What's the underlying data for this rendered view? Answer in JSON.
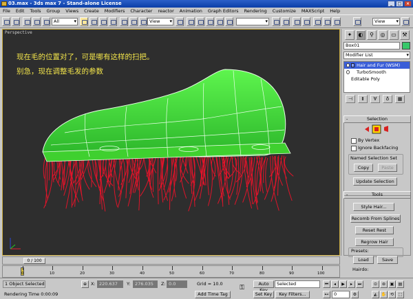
{
  "window": {
    "title": "03.max - 3ds max 7 - Stand-alone License"
  },
  "menu": [
    "File",
    "Edit",
    "Tools",
    "Group",
    "Views",
    "Create",
    "Modifiers",
    "Character",
    "reactor",
    "Animation",
    "Graph Editors",
    "Rendering",
    "Customize",
    "MAXScript",
    "Help"
  ],
  "toolbar": {
    "selection_filter": "All",
    "ref_coord": "View",
    "named_sel": "",
    "view_dropdown": "View"
  },
  "viewport": {
    "label": "Perspective",
    "note_line1": "现在毛的位置对了，可是哪有这样的扫把。",
    "note_line2": "别急，现在调整毛发的参数"
  },
  "command_panel": {
    "tab_icons": [
      "create-icon",
      "modify-icon",
      "hierarchy-icon",
      "motion-icon",
      "display-icon",
      "utilities-icon"
    ],
    "object_name": "Box01",
    "modifier_list": "Modifier List",
    "stack": [
      "Hair and Fur (WSM)",
      "TurboSmooth",
      "Editable Poly"
    ],
    "selection": {
      "title": "Selection",
      "by_vertex": "By Vertex",
      "ignore_backfacing": "Ignore Backfacing",
      "named_selection_set": "Named Selection Set",
      "copy": "Copy",
      "paste": "Paste",
      "update_selection": "Update Selection"
    },
    "tools": {
      "title": "Tools",
      "style_hair": "Style Hair...",
      "recomb": "Recomb From Splines",
      "reset_rest": "Reset Rest",
      "regrow_hair": "Regrow Hair",
      "presets": "Presets:",
      "load": "Load",
      "save": "Save",
      "hairdo": "Hairdo:"
    },
    "colors": {
      "object": "#38c86a",
      "highlight": "#3a5ed8"
    }
  },
  "timeline": {
    "frame": "0 / 100",
    "ticks": [
      "0",
      "10",
      "20",
      "30",
      "40",
      "50",
      "60",
      "70",
      "80",
      "90",
      "100"
    ]
  },
  "status": {
    "selected": "1 Object Selected",
    "render_time": "Rendering Time  0:00:09",
    "x_label": "X:",
    "x_value": "220.637",
    "y_label": "Y:",
    "y_value": "276.035",
    "z_label": "Z:",
    "z_value": "0.0",
    "grid": "Grid = 10.0",
    "add_time_tag": "Add Time Tag",
    "auto_key": "Auto Key",
    "set_key": "Set Key",
    "key_mode": "Selected",
    "key_filters": "Key Filters...",
    "frame_value": "0"
  }
}
